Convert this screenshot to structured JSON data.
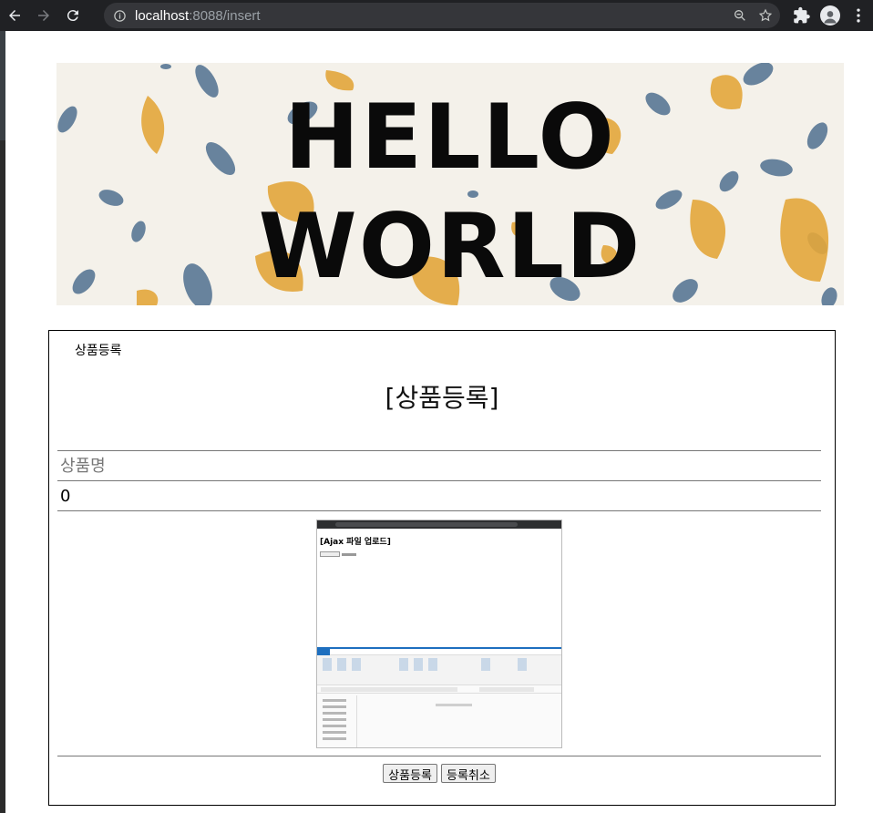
{
  "browser": {
    "url_host": "localhost",
    "url_rest": ":8088/insert"
  },
  "banner": {
    "line1": "HELLO",
    "line2": "WORLD"
  },
  "panel": {
    "crumb": "상품등록",
    "heading": "[상품등록]",
    "name_placeholder": "상품명",
    "price_value": "0",
    "submit_label": "상품등록",
    "cancel_label": "등록취소"
  },
  "preview": {
    "title": "[Ajax 파일 업로드]"
  },
  "colors": {
    "leaf_blue": "#4f6f8f",
    "leaf_orange": "#e3a63b",
    "banner_bg": "#f4f1ea"
  }
}
